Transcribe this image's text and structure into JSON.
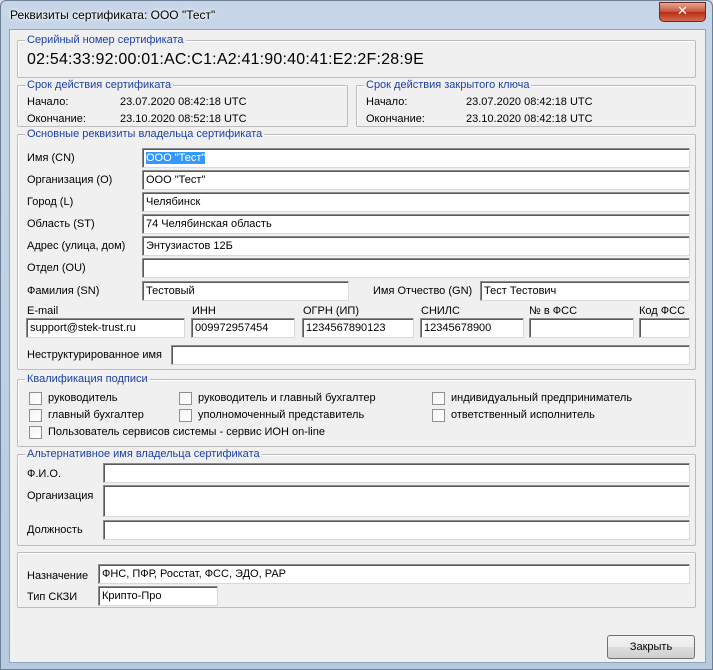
{
  "window": {
    "title": "Реквизиты сертификата: ООО \"Тест\"",
    "close_glyph": "✕"
  },
  "serial": {
    "legend": "Серийный номер сертификата",
    "value": "02:54:33:92:00:01:AC:C1:A2:41:90:40:41:E2:2F:28:9E"
  },
  "cert_validity": {
    "legend": "Срок действия сертификата",
    "start_label": "Начало:",
    "start_value": "23.07.2020 08:42:18 UTC",
    "end_label": "Окончание:",
    "end_value": "23.10.2020 08:52:18 UTC"
  },
  "key_validity": {
    "legend": "Срок действия закрытого ключа",
    "start_label": "Начало:",
    "start_value": "23.07.2020 08:42:18 UTC",
    "end_label": "Окончание:",
    "end_value": "23.10.2020 08:42:18 UTC"
  },
  "owner": {
    "legend": "Основные реквизиты владельца сертификата",
    "cn_label": "Имя (CN)",
    "cn_value": "ООО \"Тест\"",
    "org_label": "Организация (O)",
    "org_value": "ООО \"Тест\"",
    "city_label": "Город (L)",
    "city_value": "Челябинск",
    "region_label": "Область (ST)",
    "region_value": "74 Челябинская область",
    "address_label": "Адрес   (улица, дом)",
    "address_value": "Энтузиастов 12Б",
    "dept_label": "Отдел (OU)",
    "dept_value": "",
    "surname_label": "Фамилия (SN)",
    "surname_value": "Тестовый",
    "given_label": "Имя Отчество (GN)",
    "given_value": "Тест Тестович",
    "email_label": "E-mail",
    "email_value": "support@stek-trust.ru",
    "inn_label": "ИНН",
    "inn_value": "009972957454",
    "ogrn_label": "ОГРН (ИП)",
    "ogrn_value": "1234567890123",
    "snils_label": "СНИЛС",
    "snils_value": "12345678900",
    "fss_num_label": "№ в ФСС",
    "fss_num_value": "",
    "fss_code_label": "Код ФСС",
    "fss_code_value": "",
    "unstructured_label": "Неструктурированное имя",
    "unstructured_value": ""
  },
  "qualification": {
    "legend": "Квалификация подписи",
    "options": [
      "руководитель",
      "руководитель и главный бухгалтер",
      "индивидуальный предприниматель",
      "главный бухгалтер",
      "уполномоченный представитель",
      "ответственный исполнитель",
      "Пользователь сервисов системы - сервис ИОН on-line"
    ]
  },
  "alt_name": {
    "legend": "Альтернативное имя владельца сертификата",
    "fio_label": "Ф.И.О.",
    "fio_value": "",
    "org_label": "Организация",
    "org_value": "",
    "position_label": "Должность",
    "position_value": ""
  },
  "purpose": {
    "purpose_label": "Назначение",
    "purpose_value": "ФНС, ПФР, Росстат, ФСС, ЭДО, РАР",
    "skzi_label": "Тип СКЗИ",
    "skzi_value": "Крипто-Про"
  },
  "close_button": "Закрыть"
}
